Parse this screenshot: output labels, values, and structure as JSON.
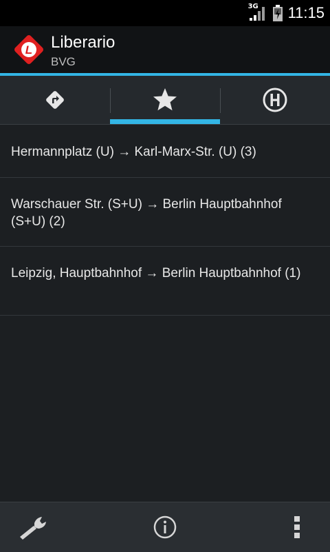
{
  "status": {
    "network": "3G",
    "time": "11:15"
  },
  "actionbar": {
    "title": "Liberario",
    "subtitle": "BVG",
    "logo_letter": "L"
  },
  "tabs": [
    {
      "name": "directions",
      "icon": "directions-icon",
      "active": false
    },
    {
      "name": "favourites",
      "icon": "star-icon",
      "active": true
    },
    {
      "name": "stations",
      "icon": "bus-stop-icon",
      "active": false
    }
  ],
  "favourites": [
    {
      "text": "Hermannplatz (U) → Karl-Marx-Str. (U) (3)"
    },
    {
      "text": "Warschauer Str. (S+U) → Berlin Hauptbahnhof (S+U) (2)"
    },
    {
      "text": "Leipzig, Hauptbahnhof → Berlin Hauptbahnhof (1)"
    }
  ],
  "bottombar": {
    "icons": [
      "wrench-icon",
      "info-icon",
      "overflow-menu-icon"
    ]
  },
  "colors": {
    "accent": "#33b5e5",
    "logo": "#e02020"
  }
}
